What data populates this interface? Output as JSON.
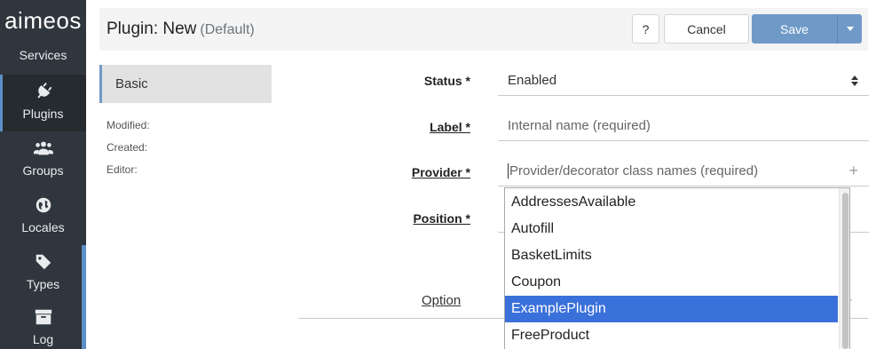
{
  "sidebar": {
    "logo": "aimeos",
    "items": [
      {
        "label": "Services",
        "icon": "services-icon"
      },
      {
        "label": "Plugins",
        "icon": "plug-icon",
        "active": true
      },
      {
        "label": "Groups",
        "icon": "users-icon"
      },
      {
        "label": "Locales",
        "icon": "globe-icon"
      },
      {
        "label": "Types",
        "icon": "tag-icon"
      },
      {
        "label": "Log",
        "icon": "archive-icon"
      }
    ]
  },
  "header": {
    "title": "Plugin: New",
    "subtitle": "(Default)",
    "help_label": "?",
    "cancel_label": "Cancel",
    "save_label": "Save"
  },
  "panel": {
    "tab_label": "Basic",
    "modified_label": "Modified:",
    "created_label": "Created:",
    "editor_label": "Editor:"
  },
  "form": {
    "status": {
      "label": "Status *",
      "value": "Enabled"
    },
    "label": {
      "label": "Label *",
      "placeholder": "Internal name (required)"
    },
    "provider": {
      "label": "Provider *",
      "placeholder": "Provider/decorator class names (required)"
    },
    "position": {
      "label": "Position *"
    },
    "option_label": "Option"
  },
  "dropdown": {
    "options": [
      "AddressesAvailable",
      "Autofill",
      "BasketLimits",
      "Coupon",
      "ExamplePlugin",
      "FreeProduct"
    ],
    "selected": "ExamplePlugin"
  },
  "colors": {
    "sidebar_bg": "#30363d",
    "accent": "#6f9ac8",
    "selection": "#3a70da"
  }
}
